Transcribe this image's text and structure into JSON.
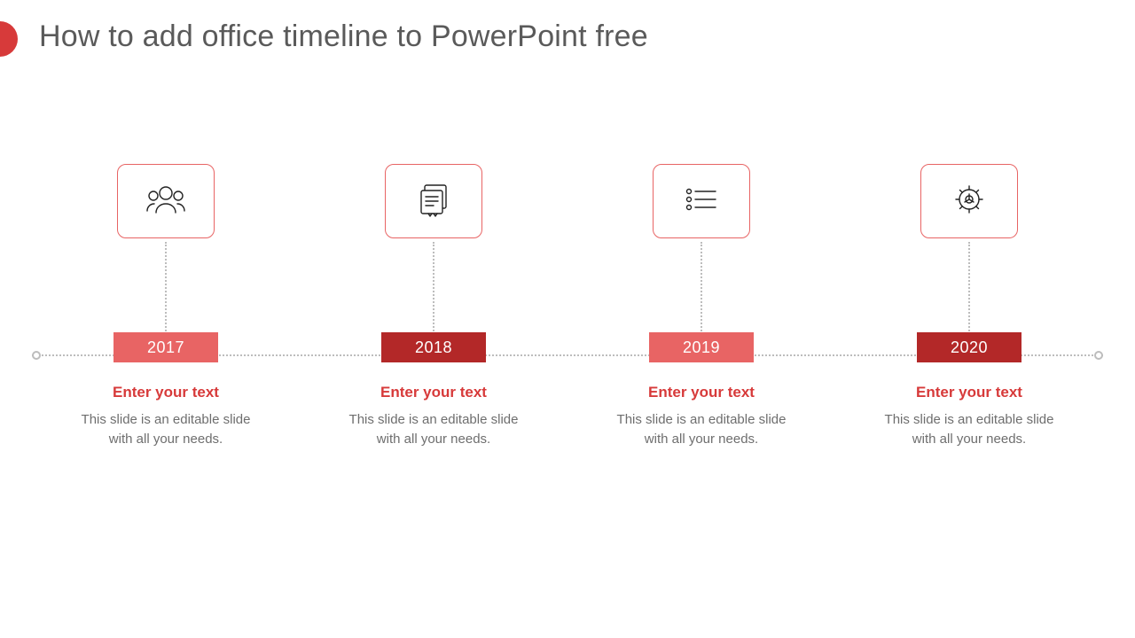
{
  "accent_color": "#D73A3A",
  "title": "How to add office timeline to PowerPoint free",
  "milestones": [
    {
      "year": "2017",
      "badge_variant": "light",
      "icon": "people-icon",
      "heading": "Enter your text",
      "description": "This slide is an editable slide with all your needs."
    },
    {
      "year": "2018",
      "badge_variant": "dark",
      "icon": "document-icon",
      "heading": "Enter your text",
      "description": "This slide is an editable slide with all your needs."
    },
    {
      "year": "2019",
      "badge_variant": "light",
      "icon": "list-icon",
      "heading": "Enter your text",
      "description": "This slide is an editable slide with all your needs."
    },
    {
      "year": "2020",
      "badge_variant": "dark",
      "icon": "gear-icon",
      "heading": "Enter your text",
      "description": "This slide is an editable slide with all your needs."
    }
  ]
}
